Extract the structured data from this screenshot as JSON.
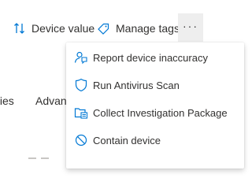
{
  "toolbar": {
    "device_value_label": "Device value",
    "manage_tags_label": "Manage tags",
    "more_label": "···"
  },
  "tabs": {
    "properties_fragment": "ties",
    "advanced_fragment": "Advanc"
  },
  "menu": {
    "items": [
      {
        "label": "Report device inaccuracy",
        "icon": "report-person-icon"
      },
      {
        "label": "Run Antivirus Scan",
        "icon": "shield-icon"
      },
      {
        "label": "Collect Investigation Package",
        "icon": "package-icon"
      },
      {
        "label": "Contain device",
        "icon": "block-icon"
      }
    ]
  },
  "colors": {
    "accent": "#0078d4",
    "text": "#323130",
    "more_button_bg": "#eeeeee"
  }
}
